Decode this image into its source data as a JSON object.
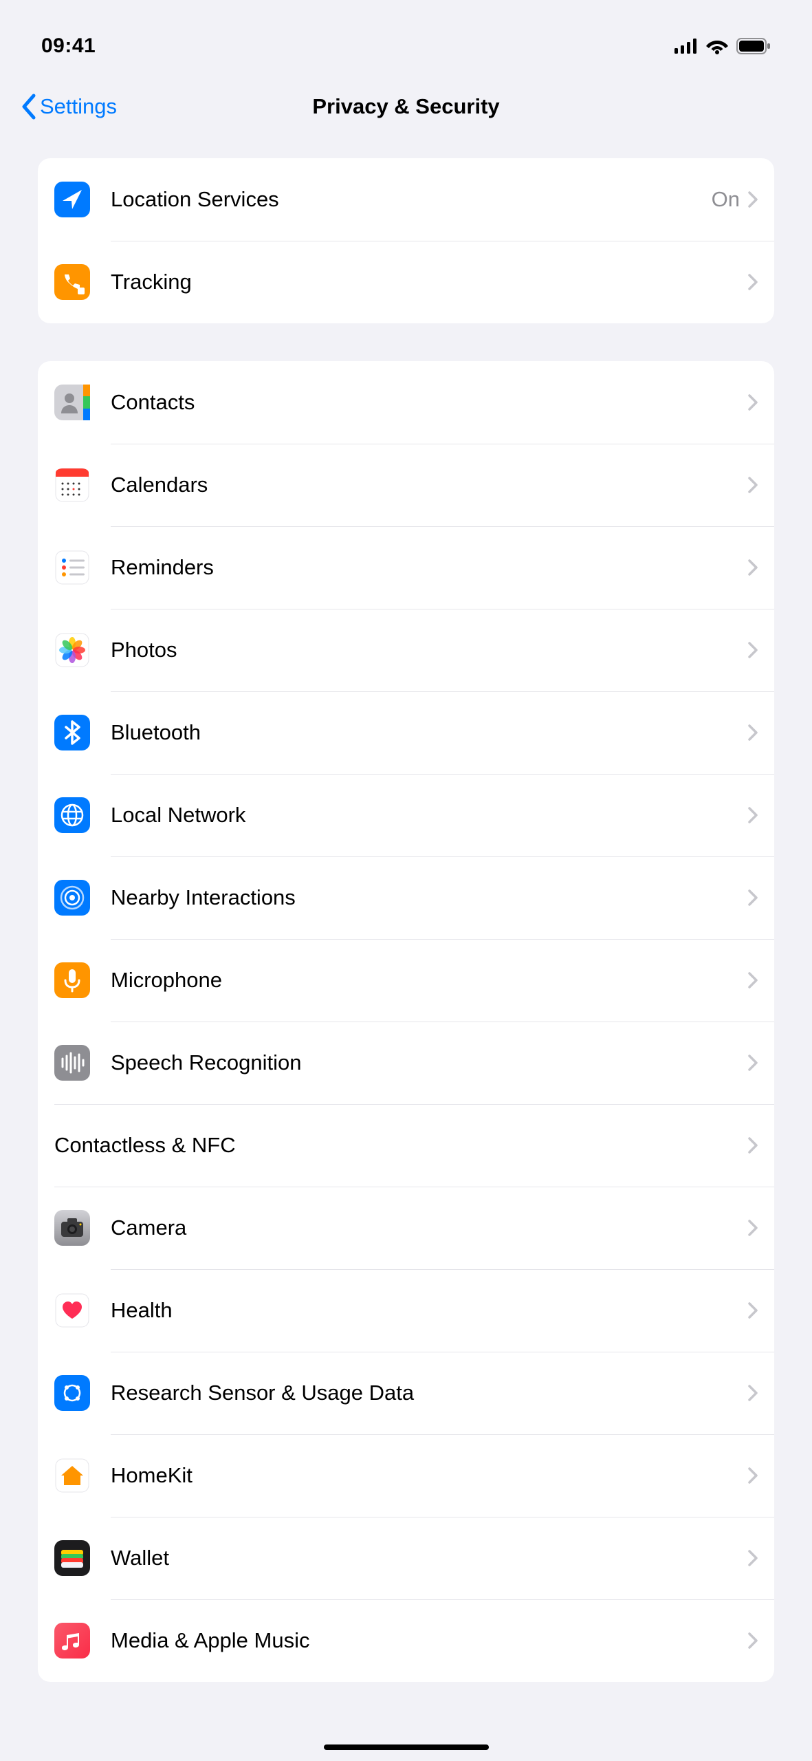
{
  "status": {
    "time": "09:41"
  },
  "nav": {
    "back": "Settings",
    "title": "Privacy & Security"
  },
  "section1": [
    {
      "label": "Location Services",
      "value": "On",
      "icon": "location"
    },
    {
      "label": "Tracking",
      "icon": "tracking"
    }
  ],
  "section2": [
    {
      "label": "Contacts",
      "icon": "contacts"
    },
    {
      "label": "Calendars",
      "icon": "calendars"
    },
    {
      "label": "Reminders",
      "icon": "reminders"
    },
    {
      "label": "Photos",
      "icon": "photos"
    },
    {
      "label": "Bluetooth",
      "icon": "bluetooth"
    },
    {
      "label": "Local Network",
      "icon": "localnetwork"
    },
    {
      "label": "Nearby Interactions",
      "icon": "nearby"
    },
    {
      "label": "Microphone",
      "icon": "microphone"
    },
    {
      "label": "Speech Recognition",
      "icon": "speech"
    },
    {
      "label": "Contactless & NFC",
      "no_icon": true
    },
    {
      "label": "Camera",
      "icon": "camera"
    },
    {
      "label": "Health",
      "icon": "health"
    },
    {
      "label": "Research Sensor & Usage Data",
      "icon": "research"
    },
    {
      "label": "HomeKit",
      "icon": "homekit"
    },
    {
      "label": "Wallet",
      "icon": "wallet"
    },
    {
      "label": "Media & Apple Music",
      "icon": "music"
    }
  ]
}
